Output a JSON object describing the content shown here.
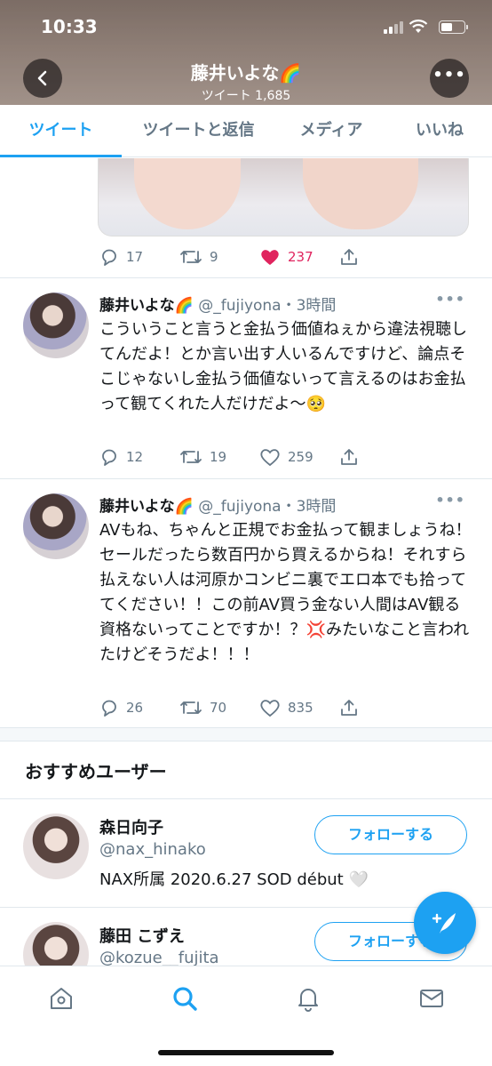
{
  "status_bar": {
    "time": "10:33"
  },
  "header": {
    "name": "藤井いよな🌈",
    "tweet_count_label": "ツイート 1,685"
  },
  "tabs": [
    {
      "label": "ツイート",
      "active": true
    },
    {
      "label": "ツイートと返信",
      "active": false
    },
    {
      "label": "メディア",
      "active": false
    },
    {
      "label": "いいね",
      "active": false
    }
  ],
  "tweets": [
    {
      "replies": "17",
      "retweets": "9",
      "likes": "237",
      "liked": true
    },
    {
      "name": "藤井いよな🌈",
      "meta": "@_fujiyona・3時間",
      "text": "こういうこと言うと金払う価値ねぇから違法視聴してんだよ！とか言い出す人いるんですけど、論点そこじゃないし金払う価値ないって言えるのはお金払って観てくれた人だけだよ〜🥺",
      "replies": "12",
      "retweets": "19",
      "likes": "259",
      "liked": false
    },
    {
      "name": "藤井いよな🌈",
      "meta": "@_fujiyona・3時間",
      "text": "AVもね、ちゃんと正規でお金払って観ましょうね！セールだったら数百円から買えるからね！それすら払えない人は河原かコンビニ裏でエロ本でも拾っててください！！この前AV買う金ない人間はAV観る資格ないってことですか！？💢みたいなこと言われたけどそうだよ！！！",
      "replies": "26",
      "retweets": "70",
      "likes": "835",
      "liked": false
    }
  ],
  "recommended": {
    "title": "おすすめユーザー",
    "users": [
      {
        "name": "森日向子",
        "handle": "@nax_hinako",
        "bio": "NAX所属 2020.6.27 SOD début 🤍",
        "follow_label": "フォローする"
      },
      {
        "name": "藤田 こずえ",
        "handle": "@kozue__fujita",
        "follow_label": "フォローする"
      }
    ]
  },
  "icons": {
    "back": "chevron-left-icon",
    "more": "more-icon",
    "reply": "reply-icon",
    "retweet": "retweet-icon",
    "like": "heart-icon",
    "share": "share-icon",
    "compose": "compose-tweet-icon",
    "nav": [
      "home-icon",
      "search-icon",
      "notifications-icon",
      "messages-icon"
    ]
  },
  "colors": {
    "accent": "#1da1f2",
    "like": "#e0245e",
    "muted": "#657786"
  }
}
